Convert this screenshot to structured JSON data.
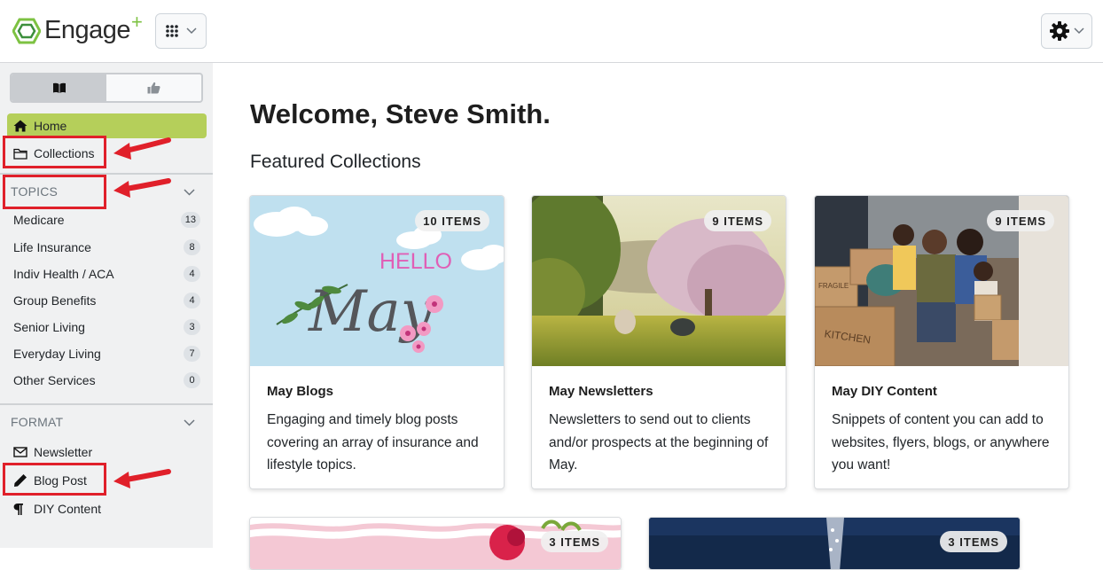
{
  "header": {
    "logo_text": "Engage",
    "logo_plus": "+",
    "apps_icon": "grid-icon",
    "settings_icon": "gear-icon"
  },
  "sidebar": {
    "toggle": [
      {
        "icon": "book-icon",
        "active": true
      },
      {
        "icon": "thumbs-up-icon",
        "active": false
      }
    ],
    "nav": [
      {
        "label": "Home",
        "icon": "home-icon"
      },
      {
        "label": "Collections",
        "icon": "folder-icon"
      }
    ],
    "topics_title": "TOPICS",
    "topics": [
      {
        "label": "Medicare",
        "count": "13"
      },
      {
        "label": "Life Insurance",
        "count": "8"
      },
      {
        "label": "Indiv Health / ACA",
        "count": "4"
      },
      {
        "label": "Group Benefits",
        "count": "4"
      },
      {
        "label": "Senior Living",
        "count": "3"
      },
      {
        "label": "Everyday Living",
        "count": "7"
      },
      {
        "label": "Other Services",
        "count": "0"
      }
    ],
    "format_title": "FORMAT",
    "formats": [
      {
        "label": "Newsletter",
        "icon": "envelope-icon"
      },
      {
        "label": "Blog Post",
        "icon": "pencil-icon"
      },
      {
        "label": "DIY Content",
        "icon": "paragraph-icon"
      }
    ]
  },
  "main": {
    "welcome": "Welcome, Steve Smith.",
    "featured_title": "Featured Collections",
    "cards": [
      {
        "badge": "10 ITEMS",
        "title": "May Blogs",
        "description": "Engaging and timely blog posts covering an array of insurance and lifestyle topics.",
        "image_hello": "HELLO",
        "image_may": "May"
      },
      {
        "badge": "9 ITEMS",
        "title": "May Newsletters",
        "description": "Newsletters to send out to clients and/or prospects at the beginning of May."
      },
      {
        "badge": "9 ITEMS",
        "title": "May DIY Content",
        "description": "Snippets of content you can add to websites, flyers, blogs, or anywhere you want!",
        "image_box1": "FRAGILE",
        "image_box2": "KITCHEN"
      }
    ],
    "more_cards": [
      {
        "badge": "3 ITEMS"
      },
      {
        "badge": "3 ITEMS"
      }
    ]
  },
  "colors": {
    "accent_green": "#b5cf5a",
    "annotation_red": "#e0202a",
    "sidebar_bg": "#f0f1f2"
  }
}
